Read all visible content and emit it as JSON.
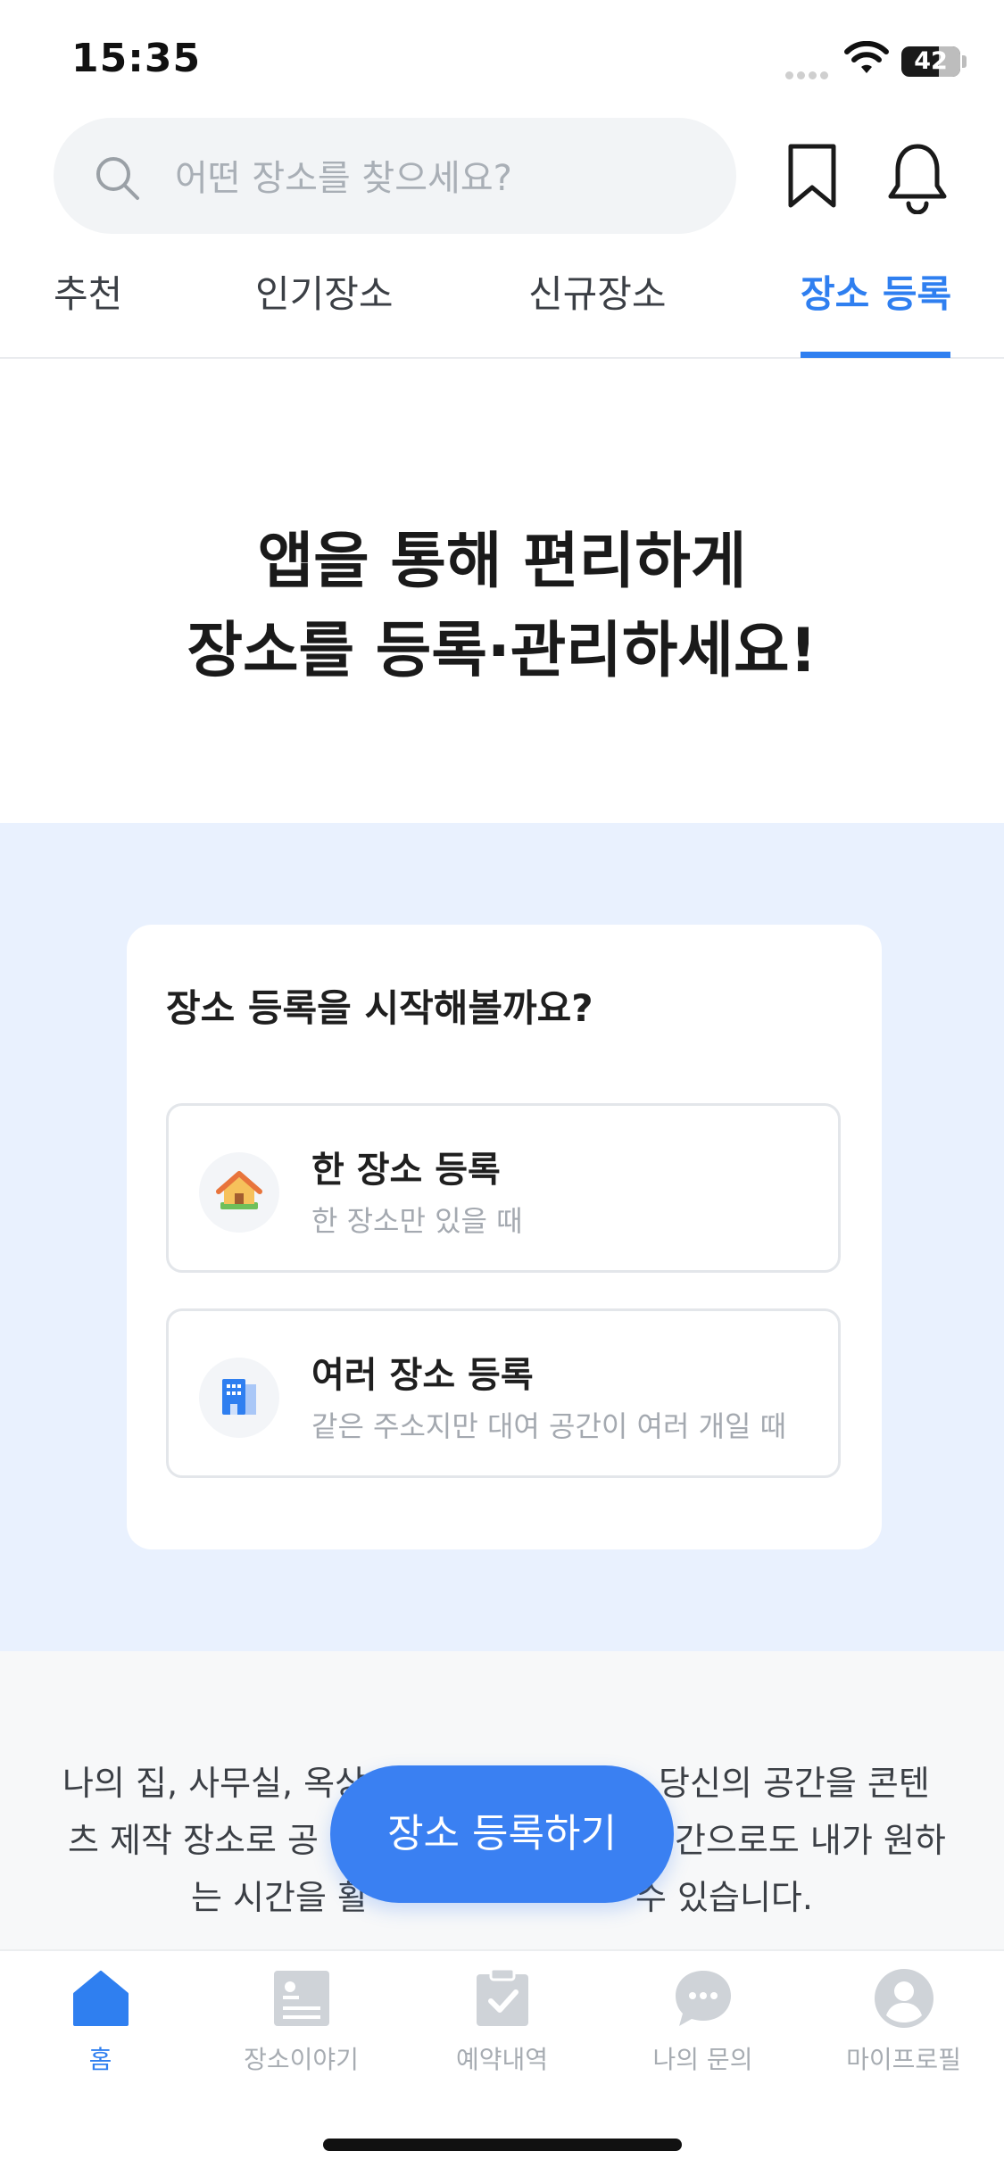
{
  "status_bar": {
    "time": "15:35",
    "battery": "42"
  },
  "search": {
    "placeholder": "어떤 장소를 찾으세요?"
  },
  "tabs": [
    {
      "label": "추천",
      "active": false
    },
    {
      "label": "인기장소",
      "active": false
    },
    {
      "label": "신규장소",
      "active": false
    },
    {
      "label": "장소 등록",
      "active": true
    }
  ],
  "headline": {
    "line1": "앱을 통해 편리하게",
    "line2": "장소를 등록·관리하세요!"
  },
  "card": {
    "title": "장소 등록을 시작해볼까요?",
    "options": [
      {
        "title": "한 장소 등록",
        "subtitle": "한 장소만 있을 때",
        "icon": "house-icon"
      },
      {
        "title": "여러 장소 등록",
        "subtitle": "같은 주소지만 대여 공간이 여러 개일 때",
        "icon": "building-icon"
      }
    ]
  },
  "description": {
    "line1": "나의 집, 사무실, 옥상",
    "line1_end": "당신의 공간을 콘텐",
    "line2": "츠 제작 장소로 공",
    "line2_end": "간으로도 내가 원하",
    "line3": "는 시간을 활",
    "line3_end": "수 있습니다."
  },
  "cta": {
    "label": "장소 등록하기"
  },
  "bottom_nav": [
    {
      "label": "홈",
      "icon": "home-icon",
      "active": true
    },
    {
      "label": "장소이야기",
      "icon": "story-icon",
      "active": false
    },
    {
      "label": "예약내역",
      "icon": "clipboard-check-icon",
      "active": false
    },
    {
      "label": "나의 문의",
      "icon": "chat-bubble-icon",
      "active": false
    },
    {
      "label": "마이프로필",
      "icon": "profile-icon",
      "active": false
    }
  ],
  "colors": {
    "accent": "#2f7ff0",
    "cta": "#3a80f2",
    "section_bg": "#e9f1fe"
  }
}
